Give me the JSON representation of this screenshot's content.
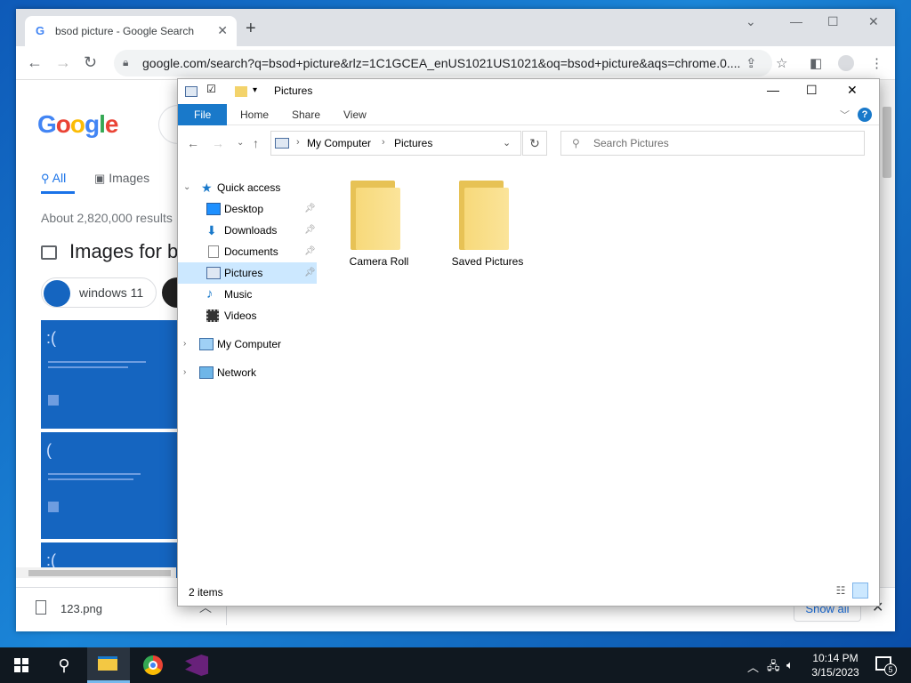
{
  "chrome": {
    "tab_title": "bsod picture - Google Search",
    "url": "google.com/search?q=bsod+picture&rlz=1C1GCEA_enUS1021US1021&oq=bsod+picture&aqs=chrome.0....",
    "google": {
      "logo": "Google",
      "tabs": [
        "All",
        "Images"
      ],
      "results_count": "About 2,820,000 results",
      "images_heading": "Images for b",
      "chip_label": "windows 11"
    },
    "download": {
      "file_name": "123.png",
      "show_all": "Show all"
    }
  },
  "explorer": {
    "title": "Pictures",
    "ribbon": [
      "File",
      "Home",
      "Share",
      "View"
    ],
    "help": "?",
    "breadcrumb": [
      "My Computer",
      "Pictures"
    ],
    "search_placeholder": "Search Pictures",
    "nav": {
      "quick_access": "Quick access",
      "items": [
        {
          "label": "Desktop",
          "pinned": true
        },
        {
          "label": "Downloads",
          "pinned": true
        },
        {
          "label": "Documents",
          "pinned": true
        },
        {
          "label": "Pictures",
          "pinned": true,
          "selected": true
        },
        {
          "label": "Music",
          "pinned": false
        },
        {
          "label": "Videos",
          "pinned": false
        }
      ],
      "my_computer": "My Computer",
      "network": "Network"
    },
    "folders": [
      "Camera Roll",
      "Saved Pictures"
    ],
    "status": "2 items"
  },
  "taskbar": {
    "time": "10:14 PM",
    "date": "3/15/2023",
    "notification_count": "5"
  },
  "colors": {
    "explorer_accent": "#1979ca",
    "selection": "#cce8ff",
    "desktop": "#1a74c9",
    "taskbar": "#101820"
  }
}
